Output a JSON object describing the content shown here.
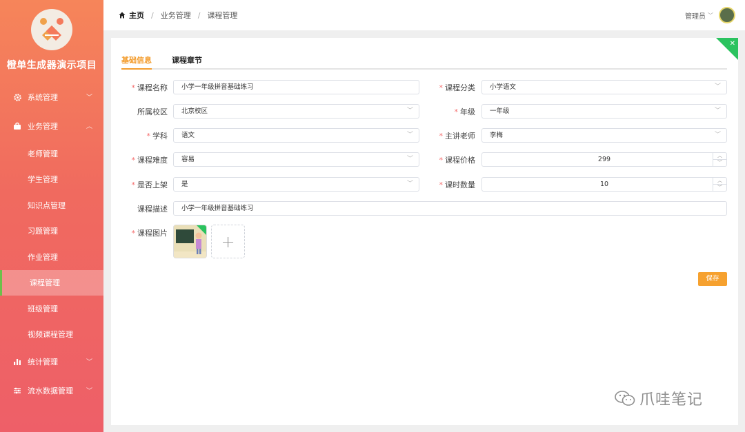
{
  "app": {
    "title": "橙单生成器演示项目"
  },
  "sidebar": {
    "groups": [
      {
        "label": "系统管理",
        "icon": "gear-icon",
        "expanded": false
      },
      {
        "label": "业务管理",
        "icon": "bag-icon",
        "expanded": true
      },
      {
        "label": "统计管理",
        "icon": "bar-chart-icon",
        "expanded": false
      },
      {
        "label": "流水数据管理",
        "icon": "sliders-icon",
        "expanded": false
      }
    ],
    "sub_items": [
      "老师管理",
      "学生管理",
      "知识点管理",
      "习题管理",
      "作业管理",
      "课程管理",
      "班级管理",
      "视频课程管理"
    ],
    "active_sub": "课程管理"
  },
  "header": {
    "breadcrumb": [
      "主页",
      "业务管理",
      "课程管理"
    ],
    "user": "管理员"
  },
  "tabs": {
    "basic": "基础信息",
    "chapters": "课程章节",
    "active": "基础信息"
  },
  "form": {
    "course_name": {
      "label": "课程名称",
      "value": "小学一年级拼音基础练习",
      "required": true
    },
    "category": {
      "label": "课程分类",
      "value": "小学语文",
      "required": true
    },
    "campus": {
      "label": "所属校区",
      "value": "北京校区",
      "required": false
    },
    "grade": {
      "label": "年级",
      "value": "一年级",
      "required": true
    },
    "subject": {
      "label": "学科",
      "value": "语文",
      "required": true
    },
    "teacher": {
      "label": "主讲老师",
      "value": "李梅",
      "required": true
    },
    "difficulty": {
      "label": "课程难度",
      "value": "容易",
      "required": true
    },
    "price": {
      "label": "课程价格",
      "value": "299",
      "required": true
    },
    "on_shelf": {
      "label": "是否上架",
      "value": "是",
      "required": true
    },
    "lesson_count": {
      "label": "课时数量",
      "value": "10",
      "required": true
    },
    "description": {
      "label": "课程描述",
      "value": "小学一年级拼音基础练习",
      "required": false
    },
    "image": {
      "label": "课程图片",
      "required": true
    }
  },
  "actions": {
    "save": "保存"
  },
  "watermark": {
    "text": "爪哇笔记"
  },
  "colors": {
    "accent": "#f39c2d",
    "sidebar_top": "#f6855a",
    "sidebar_bottom": "#ee5f68",
    "success": "#2bc35f",
    "required": "#f56c6c"
  }
}
